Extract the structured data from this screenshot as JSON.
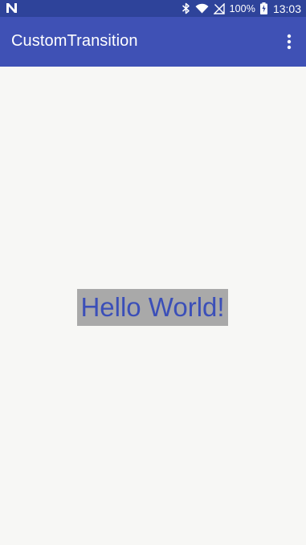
{
  "status_bar": {
    "left_icon": "n-notification-icon",
    "icons": [
      "bluetooth-icon",
      "wifi-icon",
      "no-sim-icon"
    ],
    "battery_percent": "100%",
    "battery_icon": "battery-charging-icon",
    "time": "13:03",
    "background": "#2e439a"
  },
  "app_bar": {
    "title": "CustomTransition",
    "overflow_icon": "more-vert-icon",
    "background": "#3f51b5"
  },
  "main": {
    "text": "Hello World!",
    "text_color": "#3b4fb8",
    "highlight_color": "#a9a9a9"
  }
}
